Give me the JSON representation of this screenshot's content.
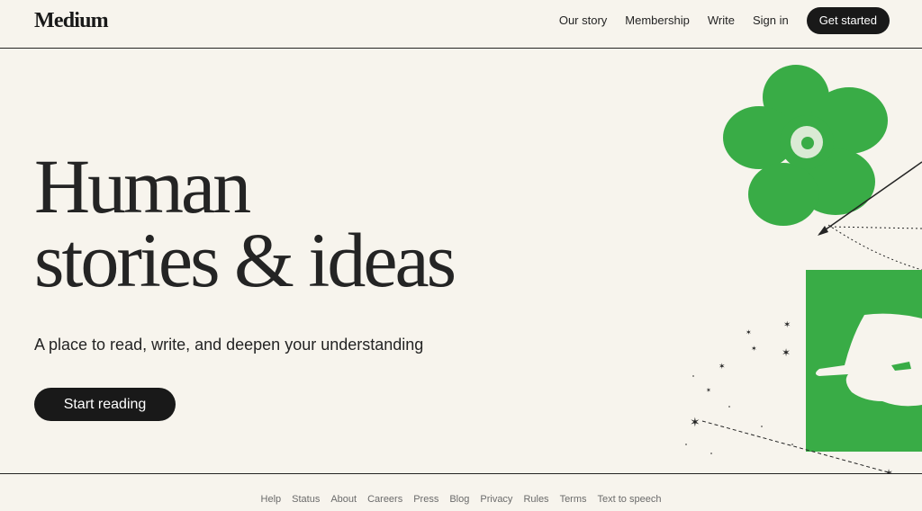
{
  "brand": {
    "name": "Medium"
  },
  "nav": {
    "our_story": "Our story",
    "membership": "Membership",
    "write": "Write",
    "sign_in": "Sign in",
    "get_started": "Get started"
  },
  "hero": {
    "title_line1": "Human",
    "title_line2": "stories & ideas",
    "subtitle": "A place to read, write, and deepen your understanding",
    "cta": "Start reading"
  },
  "footer": {
    "links": [
      "Help",
      "Status",
      "About",
      "Careers",
      "Press",
      "Blog",
      "Privacy",
      "Rules",
      "Terms",
      "Text to speech"
    ]
  },
  "colors": {
    "background": "#F7F4ED",
    "text": "#242424",
    "button": "#191919",
    "accent_green": "#39AC46"
  }
}
